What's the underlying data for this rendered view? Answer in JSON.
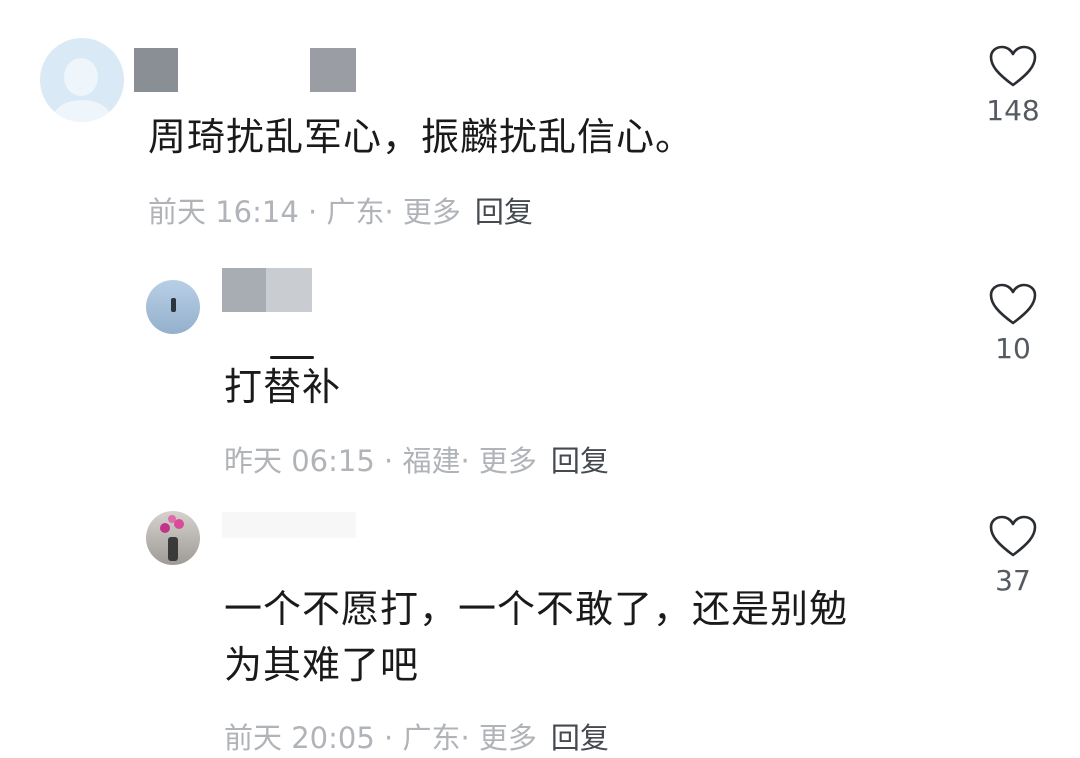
{
  "comments": [
    {
      "text": "周琦扰乱军心，振麟扰乱信心。",
      "time": "前天 16:14",
      "location": "广东",
      "more": "更多",
      "reply": "回复",
      "likes": "148"
    },
    {
      "text": "打替补",
      "time": "昨天 06:15",
      "location": "福建",
      "more": "更多",
      "reply": "回复",
      "likes": "10"
    },
    {
      "text_line1": "一个不愿打，一个不敢了，还是别勉",
      "text_line2": "为其难了吧",
      "time": "前天 20:05",
      "location": "广东",
      "more": "更多",
      "reply": "回复",
      "likes": "37"
    }
  ],
  "sep": " · ",
  "sep2": "· ",
  "icons": {
    "like": "heart-outline-icon"
  },
  "colors": {
    "meta": "#b0b3b8",
    "text": "#1a1a1a",
    "reply": "#444a50"
  }
}
